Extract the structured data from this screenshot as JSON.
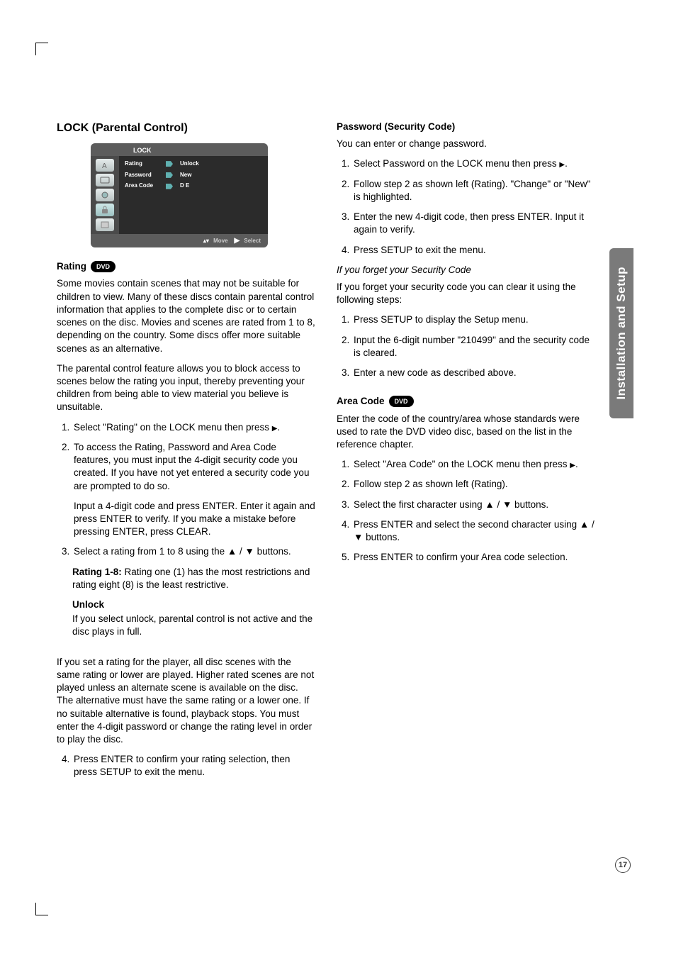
{
  "sidetab": "Installation and Setup",
  "pagenum": "17",
  "left": {
    "h2": "LOCK (Parental Control)",
    "osd": {
      "title": "LOCK",
      "rows": [
        {
          "label": "Rating",
          "value": "Unlock"
        },
        {
          "label": "Password",
          "value": "New"
        },
        {
          "label": "Area Code",
          "value": "D E"
        }
      ],
      "move": "Move",
      "select": "Select"
    },
    "rating_head": "Rating",
    "dvd": "DVD",
    "p1": "Some movies contain scenes that may not be suitable for children to view. Many of these discs contain parental control information that applies to the complete disc or to certain scenes on the disc. Movies and scenes are rated from 1 to 8, depending on the country. Some discs offer more suitable scenes as an alternative.",
    "p2": "The parental control feature allows you to block access to scenes below the rating you input, thereby preventing your children from being able to view material you believe is unsuitable.",
    "li1": "Select \"Rating\" on the LOCK menu then press ",
    "li2a": "To access the Rating, Password and Area Code features, you must input the 4-digit security code you created. If you have not yet entered a security code you are prompted to do so.",
    "li2b": "Input a 4-digit code and press ENTER. Enter it again and press ENTER to verify. If you make a mistake before pressing ENTER, press CLEAR.",
    "li3": "Select a rating from 1 to 8 using the ▲ / ▼ buttons.",
    "rating18_h": "Rating 1-8:",
    "rating18_t": " Rating one (1) has the most restrictions and rating eight (8) is the least restrictive.",
    "unlock_h": "Unlock",
    "unlock_t": "If you select unlock, parental control is not active and the disc plays in full.",
    "p3": "If you set a rating for the player, all disc scenes with the same rating or lower are played. Higher rated scenes are not played unless an alternate scene is available on the disc. The alternative must have the same rating or a lower one. If no suitable alternative is found, playback stops. You must enter the 4-digit password or change the rating level in order to play the disc.",
    "li4": "Press ENTER to confirm your rating selection, then press SETUP to exit the menu."
  },
  "right": {
    "pw_h": "Password (Security Code)",
    "pw_p1": "You can enter or change password.",
    "pw_li1": "Select Password on the LOCK menu then press ",
    "pw_li2": "Follow step 2 as shown left (Rating). \"Change\" or \"New\" is highlighted.",
    "pw_li3": "Enter the new 4-digit code, then press ENTER. Input it again to verify.",
    "pw_li4": "Press SETUP to exit the menu.",
    "forget_h": "If you forget your Security Code",
    "forget_p": "If you forget your security code you can clear it using the following steps:",
    "f_li1": "Press SETUP to display the Setup menu.",
    "f_li2": "Input the 6-digit number \"210499\" and the security code is cleared.",
    "f_li3": "Enter a new code as described above.",
    "area_h": "Area Code",
    "area_p": "Enter the code of the country/area whose standards were used to rate the DVD video disc, based on the list in the reference chapter.",
    "a_li1": "Select \"Area Code\" on the LOCK menu then press ",
    "a_li2": "Follow step 2 as shown left (Rating).",
    "a_li3": "Select the first character using ▲ / ▼ buttons.",
    "a_li4": "Press ENTER and select the second character using ▲ / ▼ buttons.",
    "a_li5": "Press ENTER to confirm your Area code selection."
  }
}
